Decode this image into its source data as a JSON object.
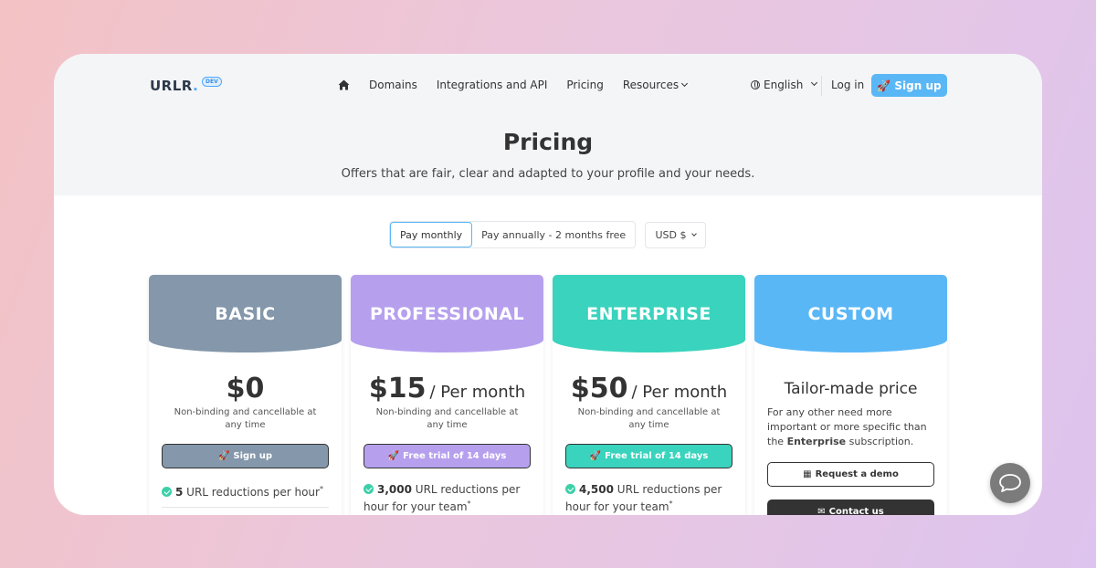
{
  "header": {
    "logo": "URLR",
    "logo_dot": ".",
    "dev_badge": "DEV",
    "nav": [
      "Domains",
      "Integrations and API",
      "Pricing",
      "Resources"
    ],
    "language": "English",
    "login": "Log in",
    "signup": "Sign up"
  },
  "hero": {
    "title": "Pricing",
    "subtitle": "Offers that are fair, clear and adapted to your profile and your needs."
  },
  "billing": {
    "monthly": "Pay monthly",
    "annually": "Pay annually - 2 months free",
    "currency": "USD $"
  },
  "plans": [
    {
      "name": "BASIC",
      "price": "$0",
      "per": "",
      "note": "Non-binding and cancellable at any time",
      "cta": "Sign up",
      "feature_num": "5",
      "feature_text": " URL reductions per hour",
      "feature_mark": "*"
    },
    {
      "name": "PROFESSIONAL",
      "price": "$15",
      "per": "/  Per month",
      "note": "Non-binding and cancellable at any time",
      "cta": "Free trial of 14 days",
      "feature_num": "3,000",
      "feature_text": " URL reductions per hour for your team",
      "feature_mark": "*"
    },
    {
      "name": "ENTERPRISE",
      "price": "$50",
      "per": "/  Per month",
      "note": "Non-binding and cancellable at any time",
      "cta": "Free trial of 14 days",
      "feature_num": "4,500",
      "feature_text": " URL reductions per hour for your team",
      "feature_mark": "*"
    },
    {
      "name": "CUSTOM",
      "price_text": "Tailor-made price",
      "desc_pre": "For any other need more important or more specific than the ",
      "desc_bold": "Enterprise",
      "desc_post": " subscription.",
      "demo": "Request a demo",
      "contact": "Contact us"
    }
  ],
  "colors": {
    "basic": "#8497ab",
    "professional": "#b6a0ee",
    "enterprise": "#3ad3bd",
    "custom": "#5ab7f6",
    "accent": "#5ab7f6"
  },
  "icons": [
    "home-icon",
    "chevron-down-icon",
    "globe-icon",
    "rocket-icon",
    "check-icon",
    "calendar-icon",
    "envelope-icon",
    "chat-icon"
  ]
}
